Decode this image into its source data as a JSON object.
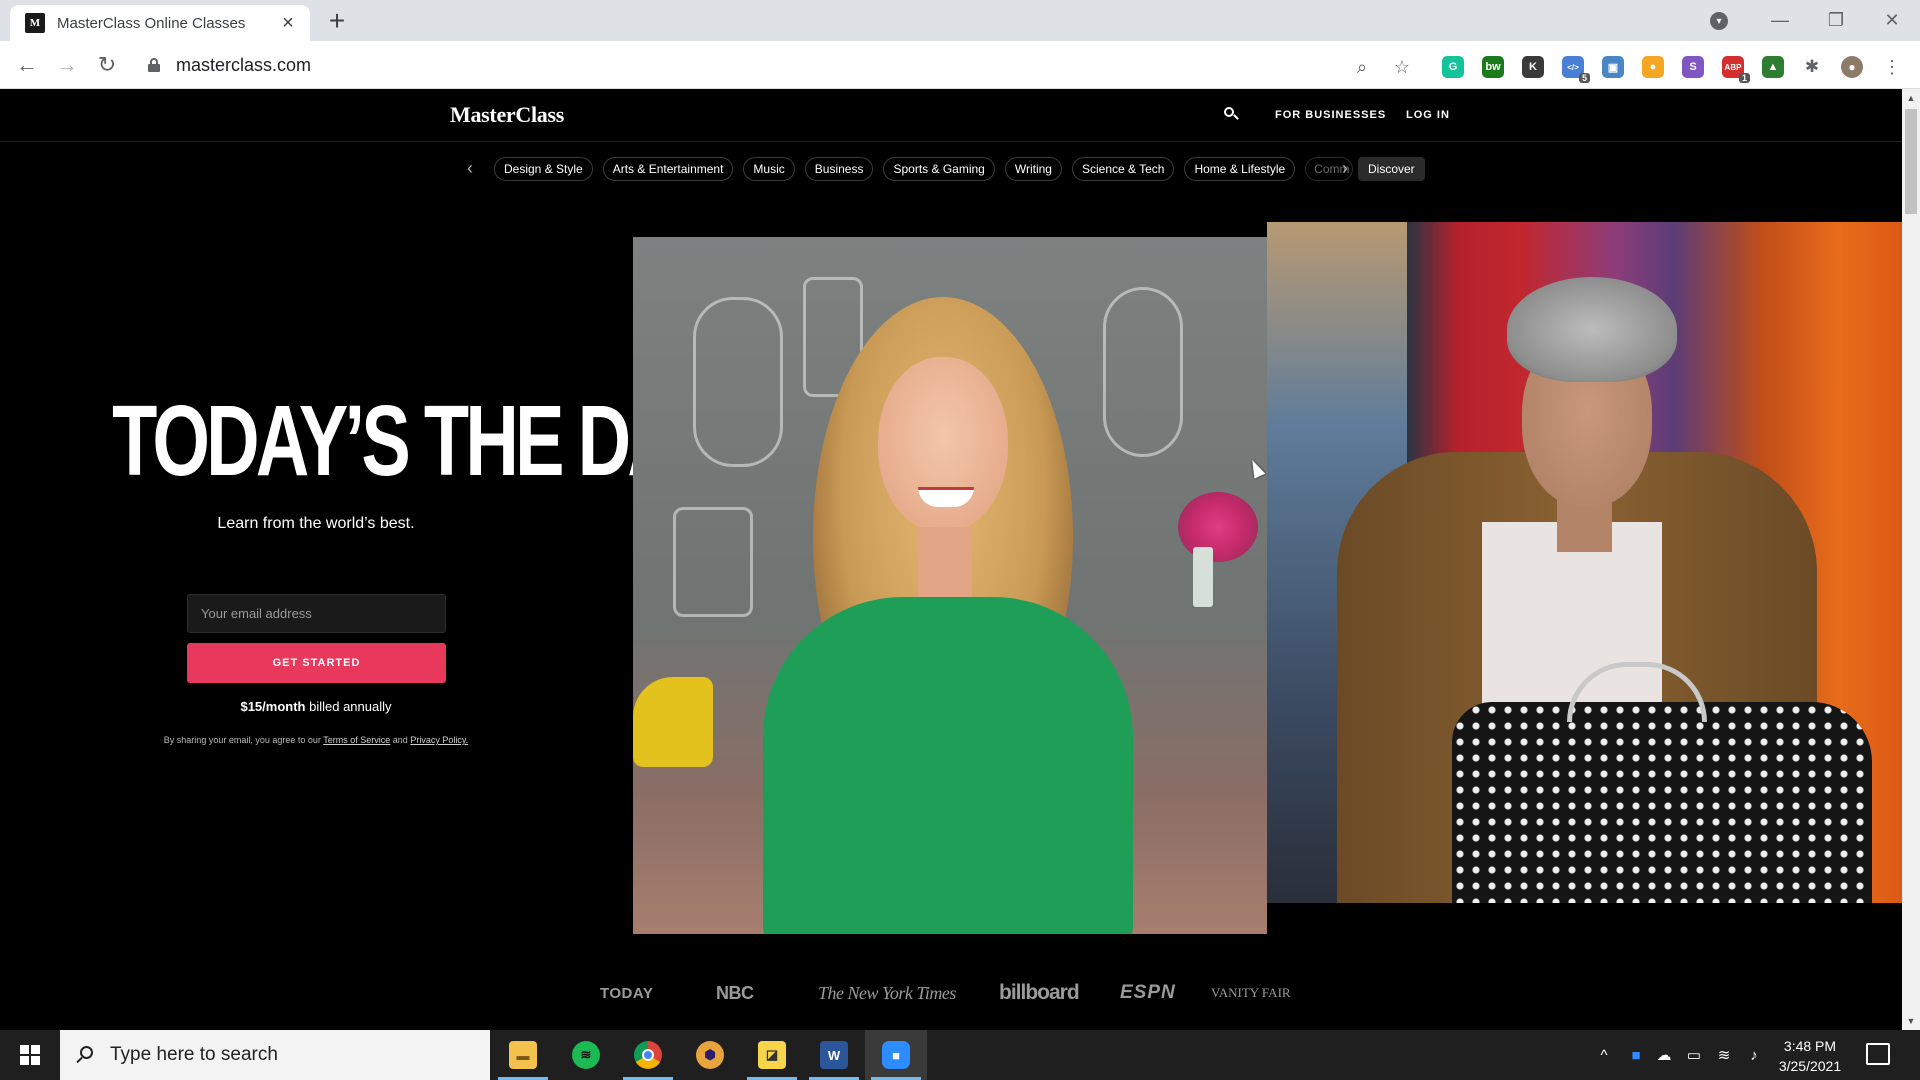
{
  "browser": {
    "tab_title": "MasterClass Online Classes",
    "tab_favicon": "M",
    "url": "masterclass.com",
    "extensions": [
      {
        "name": "grammarly-icon",
        "text": "G",
        "color": "#15c39a"
      },
      {
        "name": "bw-extension-icon",
        "text": "bw",
        "color": "#1b7a1b"
      },
      {
        "name": "k-extension-icon",
        "text": "K",
        "color": "#3a3a3a"
      },
      {
        "name": "code-extension-icon",
        "text": "</>",
        "color": "#4a7fd6",
        "badge": "5"
      },
      {
        "name": "window-extension-icon",
        "text": "▣",
        "color": "#4a86c5"
      },
      {
        "name": "orange-extension-icon",
        "text": "●",
        "color": "#f5a623"
      },
      {
        "name": "s-extension-icon",
        "text": "S",
        "color": "#7e57c2"
      },
      {
        "name": "adblock-extension-icon",
        "text": "ABP",
        "color": "#d32f2f",
        "badge": "1"
      },
      {
        "name": "drive-extension-icon",
        "text": "▲",
        "color": "#2e7d32"
      }
    ]
  },
  "site": {
    "logo": "MasterClass",
    "nav_business": "FOR BUSINESSES",
    "nav_login": "LOG IN",
    "categories": [
      "Design & Style",
      "Arts & Entertainment",
      "Music",
      "Business",
      "Sports & Gaming",
      "Writing",
      "Science & Tech",
      "Home & Lifestyle",
      "Comm"
    ],
    "discover": "Discover",
    "hero_title": "TODAY’S THE DAY.",
    "hero_subtitle": "Learn from the world’s best.",
    "email_placeholder": "Your email address",
    "cta_label": "GET STARTED",
    "price_bold": "$15/month",
    "price_rest": "billed annually",
    "legal_prefix": "By sharing your email, you agree to our",
    "legal_tos": "Terms of Service",
    "legal_and": "and",
    "legal_privacy": "Privacy Policy.",
    "press": [
      "TODAY",
      "NBC",
      "The New York Times",
      "billboard",
      "ESPN",
      "VANITY FAIR"
    ]
  },
  "taskbar": {
    "search_placeholder": "Type here to search",
    "time": "3:48 PM",
    "date": "3/25/2021"
  }
}
